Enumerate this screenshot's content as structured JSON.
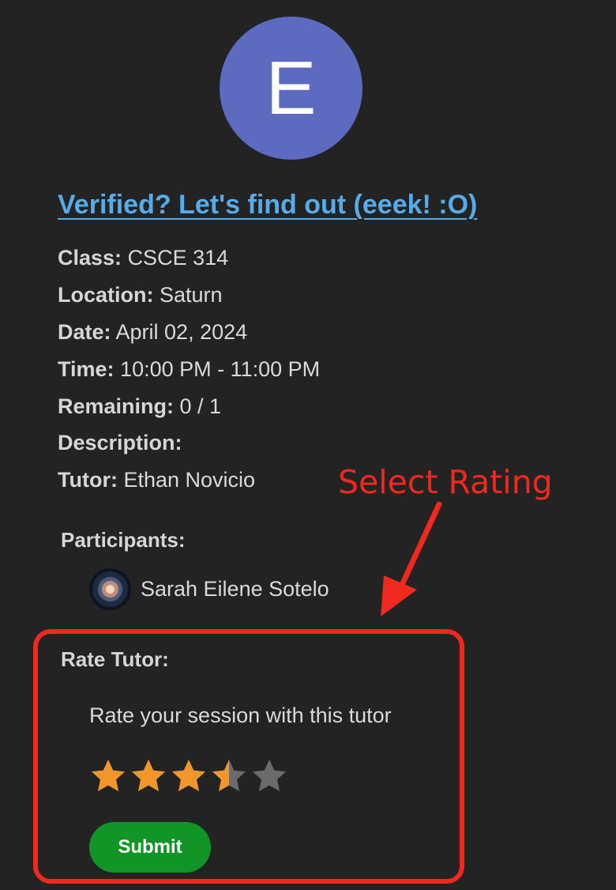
{
  "session": {
    "avatar_letter": "E",
    "title": "Verified? Let's find out (eeek! :O)",
    "details": [
      {
        "key": "Class:",
        "value": "CSCE 314"
      },
      {
        "key": "Location:",
        "value": "Saturn"
      },
      {
        "key": "Date:",
        "value": "April 02, 2024"
      },
      {
        "key": "Time:",
        "value": "10:00 PM - 11:00 PM"
      },
      {
        "key": "Remaining:",
        "value": "0 / 1"
      },
      {
        "key": "Description:",
        "value": ""
      },
      {
        "key": "Tutor:",
        "value": "Ethan Novicio"
      }
    ]
  },
  "participants": {
    "label": "Participants:",
    "items": [
      {
        "name": "Sarah Eilene Sotelo"
      }
    ]
  },
  "rating": {
    "label": "Rate Tutor:",
    "prompt": "Rate your session with this tutor",
    "value": 3.5,
    "max": 5,
    "filled_color": "#f0962a",
    "empty_color": "#6b6b6b",
    "submit_label": "Submit"
  },
  "annotation": {
    "text": "Select Rating",
    "color": "#f0281e"
  }
}
